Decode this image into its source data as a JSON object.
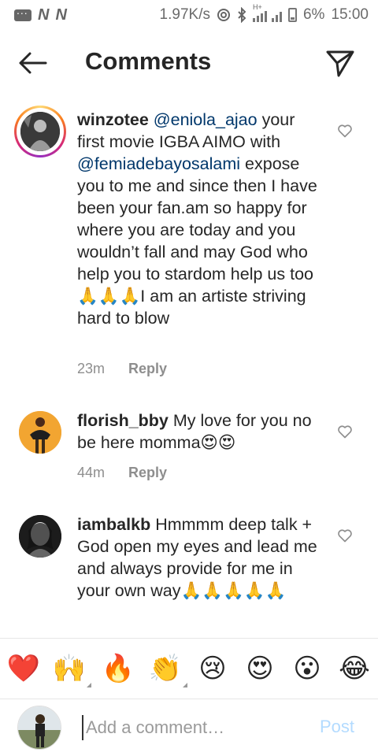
{
  "status_bar": {
    "net1": "N",
    "net2": "N",
    "speed": "1.97K/s",
    "network_label": "H+",
    "battery": "6%",
    "time": "15:00"
  },
  "header": {
    "title": "Comments",
    "back_icon": "arrow-left-icon",
    "send_icon": "paper-plane-icon"
  },
  "comments": [
    {
      "username": "winzotee",
      "segments": [
        {
          "text": "@eniola_ajao",
          "mention": true
        },
        {
          "text": " your first movie IGBA AIMO with ",
          "mention": false
        },
        {
          "text": "@femiadebayosalami",
          "mention": true
        },
        {
          "text": " expose you to me and since then I have been your fan.am so happy for where you are today and you wouldn’t fall and may God who help you to stardom help us too🙏🙏🙏I am an artiste  striving hard to blow",
          "mention": false
        }
      ],
      "time": "23m",
      "reply_label": "Reply",
      "has_story_ring": true
    },
    {
      "username": "florish_bby",
      "segments": [
        {
          "text": "My love for you no be here momma😍😍",
          "mention": false
        }
      ],
      "time": "44m",
      "reply_label": "Reply",
      "has_story_ring": false
    },
    {
      "username": "iambalkb",
      "segments": [
        {
          "text": "Hmmmm deep talk + God open my eyes and lead me and always provide for me in your own way🙏🙏🙏🙏🙏",
          "mention": false
        }
      ],
      "time": "",
      "reply_label": "",
      "has_story_ring": false
    }
  ],
  "emoji_bar": [
    {
      "char": "❤️",
      "name": "red-heart-emoji"
    },
    {
      "char": "🙌",
      "name": "raising-hands-emoji"
    },
    {
      "char": "🔥",
      "name": "fire-emoji"
    },
    {
      "char": "👏",
      "name": "clapping-hands-emoji"
    },
    {
      "char": "😢",
      "name": "crying-face-emoji"
    },
    {
      "char": "😍",
      "name": "heart-eyes-emoji"
    },
    {
      "char": "😮",
      "name": "surprised-face-emoji"
    },
    {
      "char": "😂",
      "name": "tears-of-joy-emoji"
    }
  ],
  "composer": {
    "placeholder": "Add a comment…",
    "post_label": "Post"
  },
  "colors": {
    "mention": "#00376b",
    "meta": "#8e8e8e",
    "post_disabled": "#b3dbff"
  }
}
